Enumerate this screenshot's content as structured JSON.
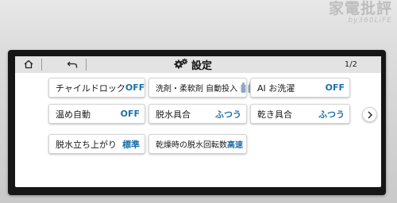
{
  "watermark": {
    "main": "家電批評",
    "sub": "by360LiFE"
  },
  "header": {
    "title": "設定",
    "page_indicator": "1/2",
    "home_icon": "home-icon",
    "back_icon": "back-arrow-icon",
    "title_icon": "gears-icon"
  },
  "settings": {
    "child_lock": {
      "label": "チャイルドロック",
      "value": "OFF"
    },
    "detergent_auto": {
      "label": "洗剤・柔軟剤 自動投入",
      "icon": "bottles-icon"
    },
    "ai_wash": {
      "label": "AI お洗濯",
      "value": "OFF"
    },
    "warm_auto": {
      "label": "温め自動",
      "value": "OFF"
    },
    "spin_level": {
      "label": "脱水具合",
      "value": "ふつう"
    },
    "dry_level": {
      "label": "乾き具合",
      "value": "ふつう"
    },
    "spin_finish": {
      "label": "脱水立ち上がり",
      "value": "標準"
    },
    "dry_spin_speed": {
      "label": "乾燥時の脱水回転数",
      "value": "高速"
    }
  },
  "next_icon": "chevron-right-icon",
  "colors": {
    "value_blue": "#1d6fa8",
    "bottle_blue": "#8fa7c9",
    "header_gray": "#e3e3e3"
  }
}
